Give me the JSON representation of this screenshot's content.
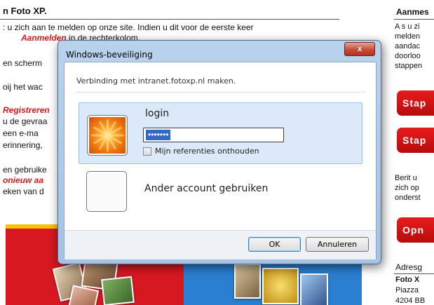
{
  "page": {
    "title": "n Foto XP.",
    "lines": [
      ": u zich aan te melden op onze site. Indien u dit voor de eerste keer",
      "",
      "en scherm",
      "oij het wac",
      "",
      "u de gevraa",
      "een e-ma",
      "erinnering,",
      "en gebruike",
      "",
      "eken van d"
    ],
    "line2_red": "Aanmelden",
    "line2_rest": " in de rechterkolom.",
    "red_registreren": "Registreren",
    "red_nieuw": "onieuw aa",
    "sidebar": {
      "title": "Aanmes",
      "lines": [
        "A s u zi",
        "melden",
        "aandac",
        "doorloo",
        "stappen"
      ],
      "buttons": [
        "Stap",
        "Stap"
      ],
      "lines2": [
        "Berit u",
        "zich op",
        "onderst"
      ],
      "button3": "Opn",
      "address_title": "Adresg",
      "address_lines": [
        "Foto X",
        "Piazza",
        "4204 BB"
      ]
    }
  },
  "dialog": {
    "title": "Windows-beveiliging",
    "close_label": "x",
    "connection_text": "Verbinding met intranet.fotoxp.nl maken.",
    "login_label": "login",
    "password_mask": "•••••••",
    "remember_label": "Mijn referenties onthouden",
    "other_account_label": "Ander account gebruiken",
    "ok_label": "OK",
    "cancel_label": "Annuleren"
  }
}
